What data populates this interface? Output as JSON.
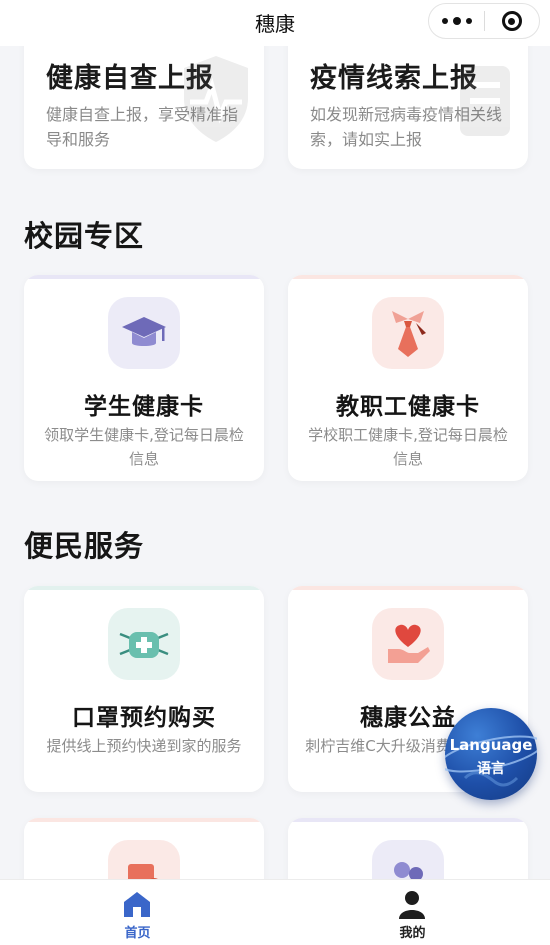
{
  "navbar": {
    "title": "穗康"
  },
  "top_cards": [
    {
      "title": "健康自查上报",
      "desc": "健康自查上报，享受精准指导和服务"
    },
    {
      "title": "疫情线索上报",
      "desc": "如发现新冠病毒疫情相关线索，请如实上报"
    }
  ],
  "sections": {
    "campus": {
      "title": "校园专区",
      "tiles": [
        {
          "title": "学生健康卡",
          "desc": "领取学生健康卡,登记每日晨检信息",
          "icon": "graduation-cap-icon",
          "accent": "#e8e6f6",
          "icon_bg": "#ecebf7"
        },
        {
          "title": "教职工健康卡",
          "desc": "学校职工健康卡,登记每日晨检信息",
          "icon": "necktie-icon",
          "accent": "#fbe6e2",
          "icon_bg": "#fbe9e6"
        }
      ]
    },
    "services": {
      "title": "便民服务",
      "tiles": [
        {
          "title": "口罩预约购买",
          "desc": "提供线上预约快递到家的服务",
          "icon": "face-mask-icon",
          "accent": "#e2f1ee",
          "icon_bg": "#e6f3f0"
        },
        {
          "title": "穗康公益",
          "desc": "刺柠吉维C大升级消费券大派送",
          "icon": "heart-hand-icon",
          "accent": "#fbe6e2",
          "icon_bg": "#fbe9e6"
        }
      ]
    }
  },
  "language_float": {
    "en": "Language",
    "zh": "语言"
  },
  "tabbar": {
    "home": "首页",
    "mine": "我的"
  },
  "colors": {
    "accent_blue": "#3a66c9",
    "background": "#f4f5f8"
  }
}
